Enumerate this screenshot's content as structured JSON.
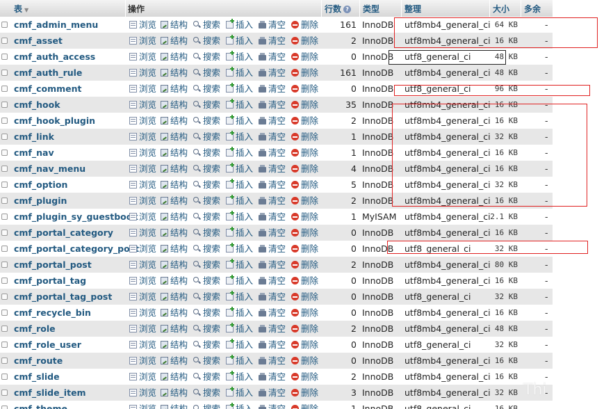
{
  "header": {
    "table": "表",
    "action": "操作",
    "rows": "行数",
    "type": "类型",
    "collation": "整理",
    "size": "大小",
    "overhead": "多余"
  },
  "actions": {
    "browse": "浏览",
    "structure": "结构",
    "search": "搜索",
    "insert": "插入",
    "empty": "清空",
    "drop": "删除"
  },
  "tables": [
    {
      "name": "cmf_admin_menu",
      "rows": "161",
      "type": "InnoDB",
      "collation": "utf8mb4_general_ci",
      "size": "64 KB",
      "overhead": "-"
    },
    {
      "name": "cmf_asset",
      "rows": "2",
      "type": "InnoDB",
      "collation": "utf8mb4_general_ci",
      "size": "16 KB",
      "overhead": "-"
    },
    {
      "name": "cmf_auth_access",
      "rows": "0",
      "type": "InnoDB",
      "collation": "utf8_general_ci",
      "size": "48 KB",
      "overhead": "-"
    },
    {
      "name": "cmf_auth_rule",
      "rows": "161",
      "type": "InnoDB",
      "collation": "utf8mb4_general_ci",
      "size": "48 KB",
      "overhead": "-"
    },
    {
      "name": "cmf_comment",
      "rows": "0",
      "type": "InnoDB",
      "collation": "utf8_general_ci",
      "size": "96 KB",
      "overhead": "-"
    },
    {
      "name": "cmf_hook",
      "rows": "35",
      "type": "InnoDB",
      "collation": "utf8mb4_general_ci",
      "size": "16 KB",
      "overhead": "-"
    },
    {
      "name": "cmf_hook_plugin",
      "rows": "2",
      "type": "InnoDB",
      "collation": "utf8mb4_general_ci",
      "size": "16 KB",
      "overhead": "-"
    },
    {
      "name": "cmf_link",
      "rows": "1",
      "type": "InnoDB",
      "collation": "utf8mb4_general_ci",
      "size": "32 KB",
      "overhead": "-"
    },
    {
      "name": "cmf_nav",
      "rows": "1",
      "type": "InnoDB",
      "collation": "utf8mb4_general_ci",
      "size": "16 KB",
      "overhead": "-"
    },
    {
      "name": "cmf_nav_menu",
      "rows": "4",
      "type": "InnoDB",
      "collation": "utf8mb4_general_ci",
      "size": "16 KB",
      "overhead": "-"
    },
    {
      "name": "cmf_option",
      "rows": "5",
      "type": "InnoDB",
      "collation": "utf8mb4_general_ci",
      "size": "32 KB",
      "overhead": "-"
    },
    {
      "name": "cmf_plugin",
      "rows": "2",
      "type": "InnoDB",
      "collation": "utf8mb4_general_ci",
      "size": "16 KB",
      "overhead": "-"
    },
    {
      "name": "cmf_plugin_sy_guestbook",
      "rows": "1",
      "type": "MyISAM",
      "collation": "utf8mb4_general_ci",
      "size": "2.1 KB",
      "overhead": "-"
    },
    {
      "name": "cmf_portal_category",
      "rows": "0",
      "type": "InnoDB",
      "collation": "utf8mb4_general_ci",
      "size": "16 KB",
      "overhead": "-"
    },
    {
      "name": "cmf_portal_category_post",
      "rows": "0",
      "type": "InnoDB",
      "collation": "utf8_general_ci",
      "size": "32 KB",
      "overhead": "-"
    },
    {
      "name": "cmf_portal_post",
      "rows": "2",
      "type": "InnoDB",
      "collation": "utf8mb4_general_ci",
      "size": "80 KB",
      "overhead": "-"
    },
    {
      "name": "cmf_portal_tag",
      "rows": "0",
      "type": "InnoDB",
      "collation": "utf8mb4_general_ci",
      "size": "16 KB",
      "overhead": "-"
    },
    {
      "name": "cmf_portal_tag_post",
      "rows": "0",
      "type": "InnoDB",
      "collation": "utf8_general_ci",
      "size": "32 KB",
      "overhead": "-"
    },
    {
      "name": "cmf_recycle_bin",
      "rows": "0",
      "type": "InnoDB",
      "collation": "utf8mb4_general_ci",
      "size": "16 KB",
      "overhead": "-"
    },
    {
      "name": "cmf_role",
      "rows": "2",
      "type": "InnoDB",
      "collation": "utf8mb4_general_ci",
      "size": "48 KB",
      "overhead": "-"
    },
    {
      "name": "cmf_role_user",
      "rows": "0",
      "type": "InnoDB",
      "collation": "utf8_general_ci",
      "size": "32 KB",
      "overhead": "-"
    },
    {
      "name": "cmf_route",
      "rows": "0",
      "type": "InnoDB",
      "collation": "utf8mb4_general_ci",
      "size": "16 KB",
      "overhead": "-"
    },
    {
      "name": "cmf_slide",
      "rows": "2",
      "type": "InnoDB",
      "collation": "utf8mb4_general_ci",
      "size": "16 KB",
      "overhead": "-"
    },
    {
      "name": "cmf_slide_item",
      "rows": "3",
      "type": "InnoDB",
      "collation": "utf8mb4_general_ci",
      "size": "32 KB",
      "overhead": "-"
    },
    {
      "name": "cmf_theme",
      "rows": "1",
      "type": "InnoDB",
      "collation": "utf8_general_ci",
      "size": "16 KB",
      "overhead": "-"
    }
  ],
  "watermark": "Thi",
  "colors": {
    "link": "#235a81",
    "row_alt": "#e7e7e7",
    "annotation_red": "#e02020"
  }
}
